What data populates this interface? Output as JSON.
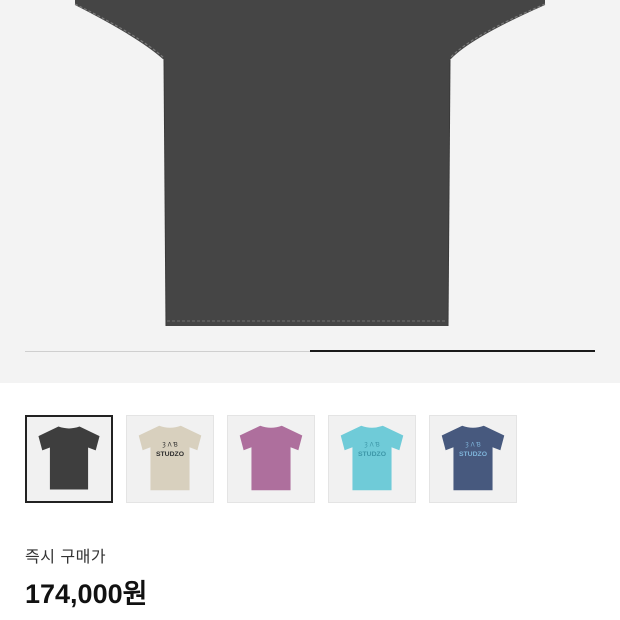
{
  "hero_image": {
    "icon": "tshirt-back-image",
    "color": "#454545"
  },
  "gallery_progress": {
    "current_fraction": 0.5
  },
  "thumbnails": [
    {
      "icon": "tshirt-thumbnail",
      "color": "#3e3e3e",
      "text_color": "#3e3e3e",
      "selected": true,
      "print_top": "",
      "print_main": ""
    },
    {
      "icon": "tshirt-thumbnail",
      "color": "#d8d0be",
      "text_color": "#2d2d2d",
      "selected": false,
      "print_top": "Ȝ Λ Ɓ",
      "print_main": "STUDZO"
    },
    {
      "icon": "tshirt-thumbnail",
      "color": "#ae6f9d",
      "text_color": "#9b5a88",
      "selected": false,
      "print_top": "",
      "print_main": ""
    },
    {
      "icon": "tshirt-thumbnail",
      "color": "#6fcbd8",
      "text_color": "#3d97a8",
      "selected": false,
      "print_top": "Ȝ Λ Ɓ",
      "print_main": "STUDZO"
    },
    {
      "icon": "tshirt-thumbnail",
      "color": "#47597e",
      "text_color": "#7fb4da",
      "selected": false,
      "print_top": "Ȝ Λ Ɓ",
      "print_main": "STUDZO"
    }
  ],
  "price": {
    "label": "즉시 구매가",
    "value": "174,000원"
  }
}
